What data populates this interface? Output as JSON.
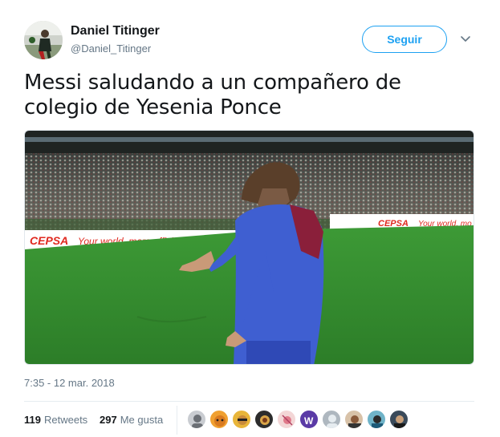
{
  "tweet": {
    "author": {
      "display_name": "Daniel Titinger",
      "handle": "@Daniel_Titinger"
    },
    "follow_label": "Seguir",
    "text": "Messi saludando a un compañero de colegio de Yesenia Ponce",
    "timestamp": "7:35 - 12 mar. 2018"
  },
  "stats": {
    "retweets_count": "119",
    "retweets_label": "Retweets",
    "likes_count": "297",
    "likes_label": "Me gusta"
  },
  "likers_count_shown": 10,
  "colors": {
    "accent": "#1da1f2",
    "muted": "#657786",
    "pitch": "#2f8a2a",
    "jersey": "#3f5fd1"
  }
}
